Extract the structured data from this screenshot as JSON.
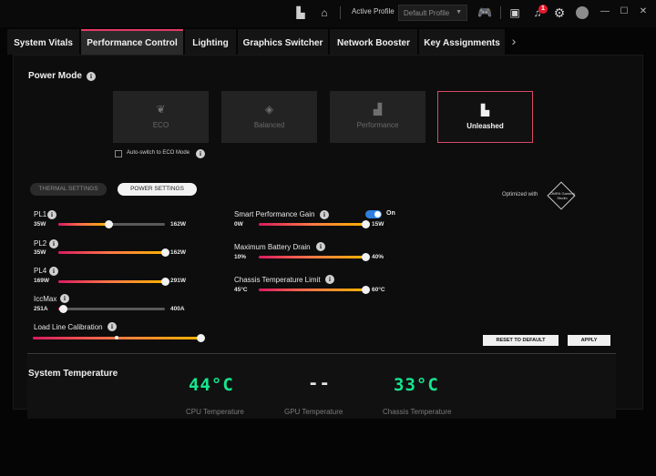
{
  "titlebar": {
    "active_profile_label": "Active Profile",
    "profile_value": "Default Profile",
    "notification_count": "1"
  },
  "tabs": [
    {
      "label": "System Vitals"
    },
    {
      "label": "Performance Control",
      "active": true
    },
    {
      "label": "Lighting"
    },
    {
      "label": "Graphics Switcher"
    },
    {
      "label": "Network Booster"
    },
    {
      "label": "Key Assignments"
    }
  ],
  "power_mode": {
    "title": "Power Mode",
    "modes": [
      {
        "label": "ECO",
        "icon": "leaf-icon"
      },
      {
        "label": "Balanced",
        "icon": "balanced-icon"
      },
      {
        "label": "Performance",
        "icon": "performance-icon"
      },
      {
        "label": "Unleashed",
        "icon": "unleashed-icon",
        "selected": true
      }
    ],
    "auto_switch_label": "Auto-switch to ECO Mode",
    "auto_switch_checked": false
  },
  "settings_tabs": {
    "thermal": "THERMAL SETTINGS",
    "power": "POWER SETTINGS",
    "active": "power"
  },
  "optimized_with": "Optimized with",
  "omen_badge_text": "OMEN Gaming Studio",
  "power_sliders": {
    "pl1": {
      "label": "PL1",
      "min": "35W",
      "max": "162W",
      "level": 0.47
    },
    "pl2": {
      "label": "PL2",
      "min": "35W",
      "max": "162W",
      "level": 1.0
    },
    "pl4": {
      "label": "PL4",
      "min": "169W",
      "max": "291W",
      "level": 1.0
    },
    "iccmax": {
      "label": "IccMax",
      "min": "251A",
      "max": "400A",
      "level": 0.04
    },
    "llc": {
      "label": "Load Line Calibration",
      "steps": 3,
      "level": 1.0
    }
  },
  "right_settings": {
    "spg": {
      "label": "Smart Performance Gain",
      "toggle_label": "On",
      "toggle_on": true,
      "min": "0W",
      "max": "15W",
      "level": 1.0
    },
    "battery_drain": {
      "label": "Maximum Battery Drain",
      "min": "10%",
      "max": "40%",
      "level": 1.0
    },
    "chassis_limit": {
      "label": "Chassis Temperature Limit",
      "min": "45°C",
      "max": "60°C",
      "level": 1.0
    }
  },
  "buttons": {
    "reset": "RESET TO DEFAULT",
    "apply": "APPLY"
  },
  "system_temperature": {
    "title": "System Temperature",
    "cpu": {
      "value": "44°C",
      "label": "CPU Temperature"
    },
    "gpu": {
      "value": "--",
      "label": "GPU Temperature"
    },
    "chassis": {
      "value": "33°C",
      "label": "Chassis Temperature"
    }
  },
  "colors": {
    "accent": "#e23a64",
    "temp_green": "#16e58f",
    "toggle_blue": "#2f7fe0"
  }
}
